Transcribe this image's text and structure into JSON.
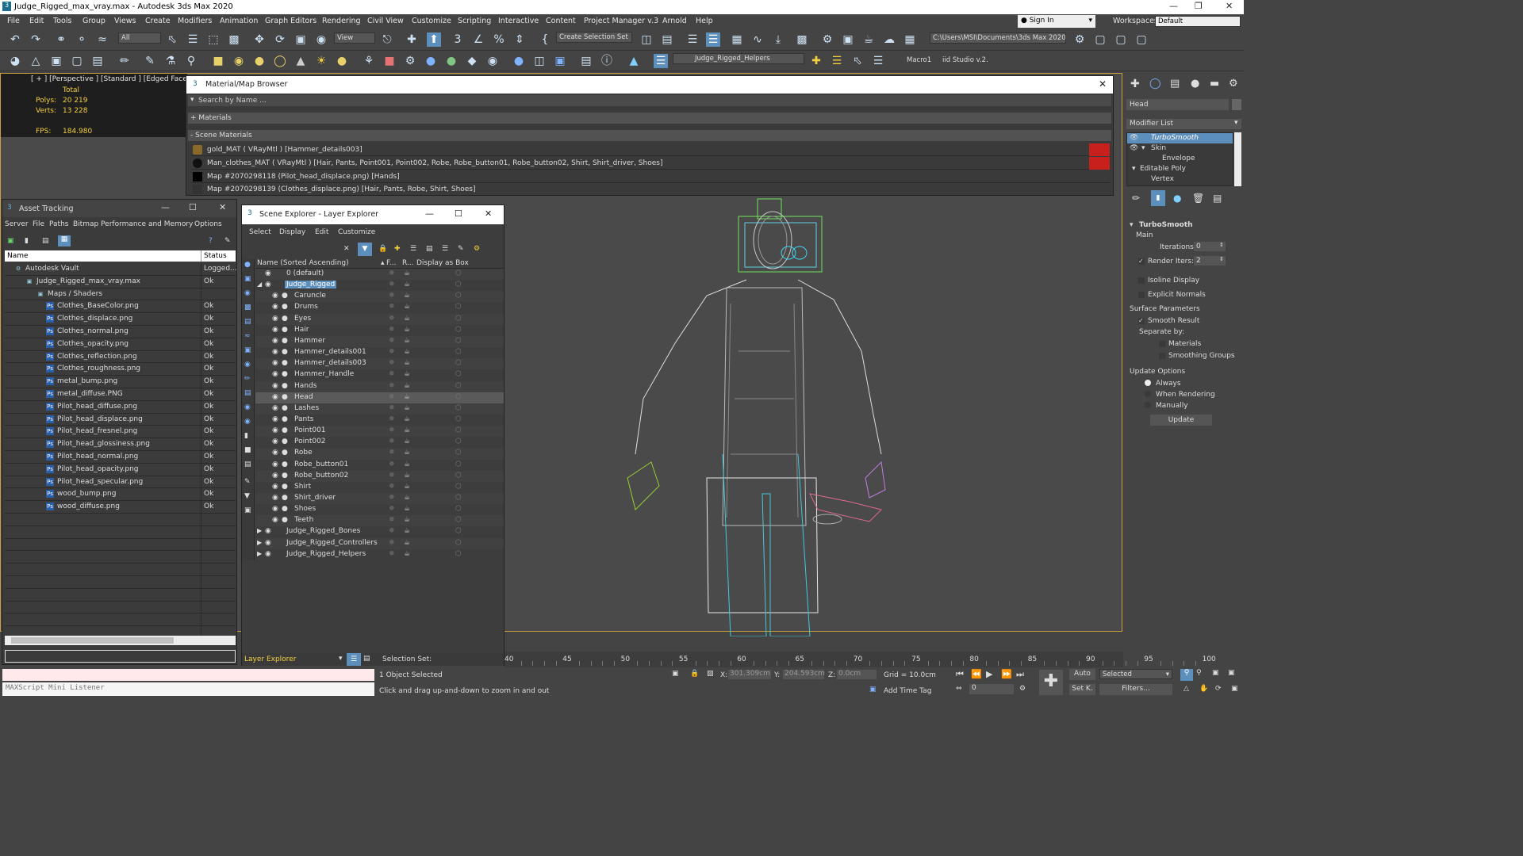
{
  "title": "Judge_Rigged_max_vray.max - Autodesk 3ds Max 2020",
  "menu": [
    "File",
    "Edit",
    "Tools",
    "Group",
    "Views",
    "Create",
    "Modifiers",
    "Animation",
    "Graph Editors",
    "Rendering",
    "Civil View",
    "Customize",
    "Scripting",
    "Interactive",
    "Content",
    "Project Manager v.3",
    "Arnold",
    "Help"
  ],
  "signin": "Sign In",
  "workspaces_label": "Workspaces:",
  "workspace_value": "Default",
  "toolbar": {
    "filter": "All",
    "view": "View",
    "selection_set": "Create Selection Set",
    "path": "C:\\Users\\MSI\\Documents\\3ds Max 2020",
    "layer": "Judge_Rigged_Helpers",
    "macro": "Macro1",
    "studio": "iid Studio v.2."
  },
  "viewport": {
    "label": "[ + ] [Perspective ]  [Standard ] [Edged Faces ]",
    "total": "Total",
    "polys_label": "Polys:",
    "polys": "20 219",
    "verts_label": "Verts:",
    "verts": "13 228",
    "fps_label": "FPS:",
    "fps": "184.980"
  },
  "material_browser": {
    "title": "Material/Map Browser",
    "search_placeholder": "Search by Name ...",
    "materials": "+ Materials",
    "scene_materials": "- Scene Materials",
    "items": [
      "gold_MAT  ( VRayMtl )  [Hammer_details003]",
      "Man_clothes_MAT  ( VRayMtl )  [Hair, Pants, Point001, Point002, Robe, Robe_button01, Robe_button02, Shirt, Shirt_driver, Shoes]",
      "Map #2070298118 (Pilot_head_displace.png)  [Hands]",
      "Map #2070298139 (Clothes_displace.png)  [Hair, Pants, Robe, Shirt, Shoes]"
    ]
  },
  "asset_tracking": {
    "title": "Asset Tracking",
    "menu": [
      "Server",
      "File",
      "Paths",
      "Bitmap Performance and Memory",
      "Options"
    ],
    "col_name": "Name",
    "col_status": "Status",
    "rows": [
      {
        "name": "Autodesk Vault",
        "status": "Logged...",
        "indent": 1
      },
      {
        "name": "Judge_Rigged_max_vray.max",
        "status": "Ok",
        "indent": 2
      },
      {
        "name": "Maps / Shaders",
        "status": "",
        "indent": 3
      },
      {
        "name": "Clothes_BaseColor.png",
        "status": "Ok",
        "indent": 4
      },
      {
        "name": "Clothes_displace.png",
        "status": "Ok",
        "indent": 4
      },
      {
        "name": "Clothes_normal.png",
        "status": "Ok",
        "indent": 4
      },
      {
        "name": "Clothes_opacity.png",
        "status": "Ok",
        "indent": 4
      },
      {
        "name": "Clothes_reflection.png",
        "status": "Ok",
        "indent": 4
      },
      {
        "name": "Clothes_roughness.png",
        "status": "Ok",
        "indent": 4
      },
      {
        "name": "metal_bump.png",
        "status": "Ok",
        "indent": 4
      },
      {
        "name": "metal_diffuse.PNG",
        "status": "Ok",
        "indent": 4
      },
      {
        "name": "Pilot_head_diffuse.png",
        "status": "Ok",
        "indent": 4
      },
      {
        "name": "Pilot_head_displace.png",
        "status": "Ok",
        "indent": 4
      },
      {
        "name": "Pilot_head_fresnel.png",
        "status": "Ok",
        "indent": 4
      },
      {
        "name": "Pilot_head_glossiness.png",
        "status": "Ok",
        "indent": 4
      },
      {
        "name": "Pilot_head_normal.png",
        "status": "Ok",
        "indent": 4
      },
      {
        "name": "Pilot_head_opacity.png",
        "status": "Ok",
        "indent": 4
      },
      {
        "name": "Pilot_head_specular.png",
        "status": "Ok",
        "indent": 4
      },
      {
        "name": "wood_bump.png",
        "status": "Ok",
        "indent": 4
      },
      {
        "name": "wood_diffuse.png",
        "status": "Ok",
        "indent": 4
      }
    ]
  },
  "scene_explorer": {
    "title": "Scene Explorer - Layer Explorer",
    "menu": [
      "Select",
      "Display",
      "Edit",
      "Customize"
    ],
    "col_name": "Name (Sorted Ascending)",
    "col_f": "F...",
    "col_r": "R...",
    "col_box": "Display as Box",
    "rows": [
      {
        "name": "0 (default)",
        "level": 0
      },
      {
        "name": "Judge_Rigged",
        "level": 0,
        "expanded": true,
        "highlight": true
      },
      {
        "name": "Caruncle",
        "level": 1
      },
      {
        "name": "Drums",
        "level": 1
      },
      {
        "name": "Eyes",
        "level": 1
      },
      {
        "name": "Hair",
        "level": 1
      },
      {
        "name": "Hammer",
        "level": 1
      },
      {
        "name": "Hammer_details001",
        "level": 1
      },
      {
        "name": "Hammer_details003",
        "level": 1
      },
      {
        "name": "Hammer_Handle",
        "level": 1
      },
      {
        "name": "Hands",
        "level": 1
      },
      {
        "name": "Head",
        "level": 1,
        "selected": true
      },
      {
        "name": "Lashes",
        "level": 1
      },
      {
        "name": "Pants",
        "level": 1
      },
      {
        "name": "Point001",
        "level": 1
      },
      {
        "name": "Point002",
        "level": 1
      },
      {
        "name": "Robe",
        "level": 1
      },
      {
        "name": "Robe_button01",
        "level": 1
      },
      {
        "name": "Robe_button02",
        "level": 1
      },
      {
        "name": "Shirt",
        "level": 1
      },
      {
        "name": "Shirt_driver",
        "level": 1
      },
      {
        "name": "Shoes",
        "level": 1
      },
      {
        "name": "Teeth",
        "level": 1
      },
      {
        "name": "Judge_Rigged_Bones",
        "level": 0,
        "collapsed": true
      },
      {
        "name": "Judge_Rigged_Controllers",
        "level": 0,
        "collapsed": true
      },
      {
        "name": "Judge_Rigged_Helpers",
        "level": 0,
        "collapsed": true
      }
    ],
    "footer_left": "Layer Explorer",
    "footer_right": "Selection Set:"
  },
  "command_panel": {
    "object_name": "Head",
    "modifier_list": "Modifier List",
    "stack": [
      "TurboSmooth",
      "Skin",
      "Envelope",
      "Editable Poly",
      "Vertex"
    ],
    "rollout": "TurboSmooth",
    "main": "Main",
    "iterations_label": "Iterations:",
    "iterations": "0",
    "render_iters_label": "Render Iters:",
    "render_iters": "2",
    "isoline": "Isoline Display",
    "explicit": "Explicit Normals",
    "surface_params": "Surface Parameters",
    "smooth_result": "Smooth Result",
    "separate_by": "Separate by:",
    "materials": "Materials",
    "smoothing_groups": "Smoothing Groups",
    "update_options": "Update Options",
    "always": "Always",
    "when_rendering": "When Rendering",
    "manually": "Manually",
    "update_btn": "Update"
  },
  "timeline": {
    "ticks": [
      "40",
      "45",
      "50",
      "55",
      "60",
      "65",
      "70",
      "75",
      "80",
      "85",
      "90",
      "95",
      "100"
    ]
  },
  "status": {
    "maxscript": "MAXScript Mini Listener",
    "selected": "1 Object Selected",
    "hint": "Click and drag up-and-down to zoom in and out",
    "x_label": "X:",
    "x": "301.309cm",
    "y_label": "Y:",
    "y": "204.593cm",
    "z_label": "Z:",
    "z": "0.0cm",
    "grid": "Grid = 10.0cm",
    "add_time_tag": "Add Time Tag",
    "auto": "Auto",
    "setk": "Set K.",
    "selected_dd": "Selected",
    "filters": "Filters...",
    "frame": "0"
  }
}
